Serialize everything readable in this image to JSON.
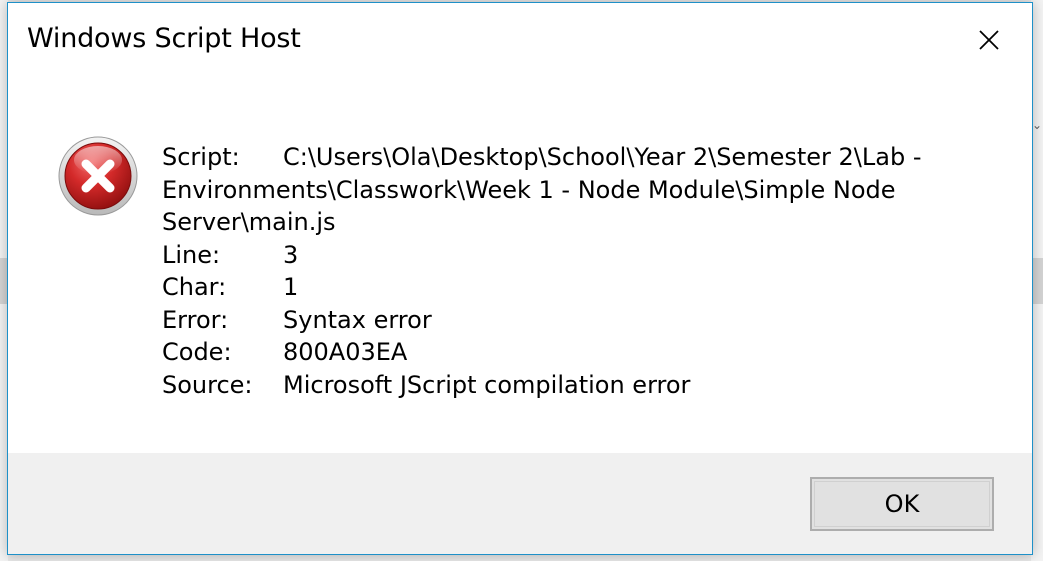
{
  "window": {
    "title": "Windows Script Host"
  },
  "icons": {
    "close": "close-icon",
    "error": "error-icon"
  },
  "message": {
    "script_label": "Script:",
    "script_value_line1": "C:\\Users\\Ola\\Desktop\\School\\Year 2\\Semester 2\\Lab -",
    "script_value_line2": "Environments\\Classwork\\Week 1 - Node Module\\Simple Node",
    "script_value_line3": "Server\\main.js",
    "line_label": "Line:",
    "line_value": "3",
    "char_label": "Char:",
    "char_value": "1",
    "error_label": "Error:",
    "error_value": "Syntax error",
    "code_label": "Code:",
    "code_value": "800A03EA",
    "source_label": "Source:",
    "source_value": "Microsoft JScript compilation error"
  },
  "buttons": {
    "ok_label": "OK"
  },
  "colors": {
    "dialog_border": "#1e90c8",
    "footer_bg": "#f0f0f0",
    "error_red": "#c8171d"
  }
}
